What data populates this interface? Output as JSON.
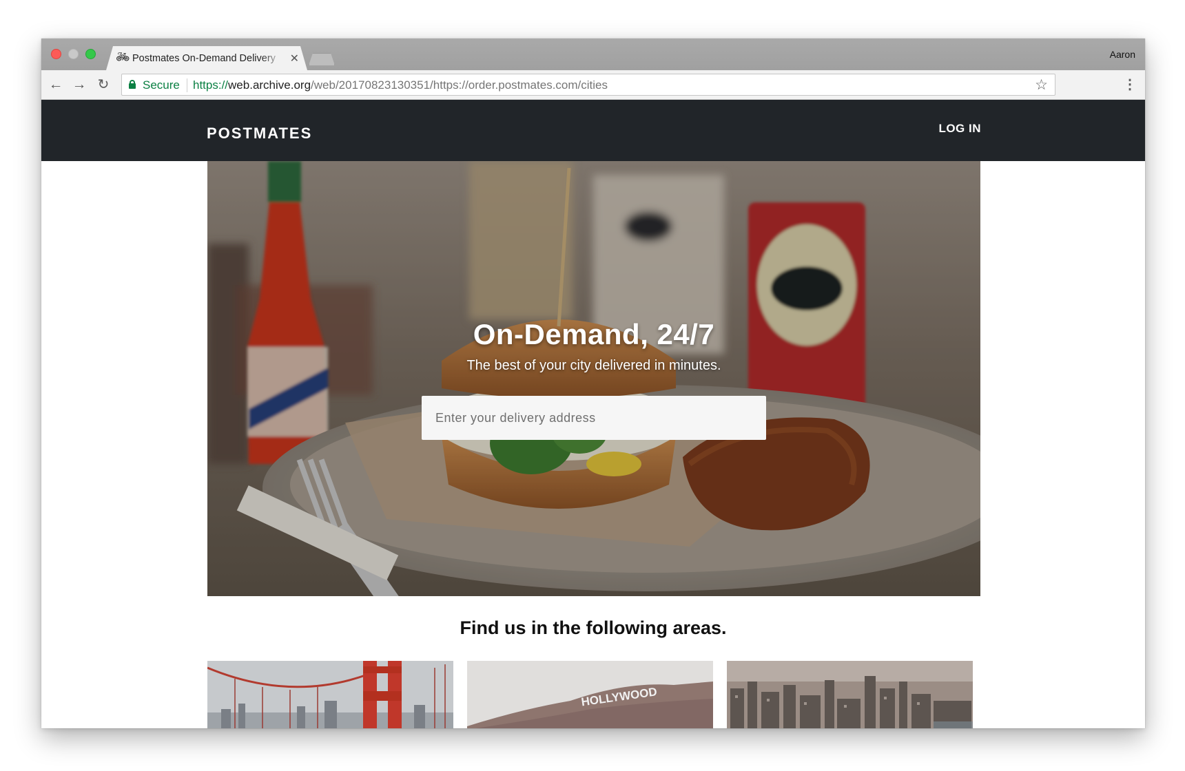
{
  "browser": {
    "tab_title": "Postmates On-Demand Delivery",
    "profile_name": "Aaron",
    "secure_label": "Secure",
    "url_scheme": "https://",
    "url_host": "web.archive.org",
    "url_path": "/web/20170823130351/https://order.postmates.com/cities"
  },
  "site": {
    "logo": "POSTMATES",
    "login": "LOG IN",
    "hero_title": "On-Demand, 24/7",
    "hero_subtitle": "The best of your city delivered in minutes.",
    "address_placeholder": "Enter your delivery address",
    "areas_heading": "Find us in the following areas.",
    "area_cards": [
      {
        "image": "golden-gate-bridge"
      },
      {
        "image": "hollywood-sign",
        "sign_text": "HOLLYWOOD"
      },
      {
        "image": "city-skyline"
      }
    ]
  },
  "colors": {
    "header_bg": "#212529",
    "secure_green": "#0b8043"
  }
}
